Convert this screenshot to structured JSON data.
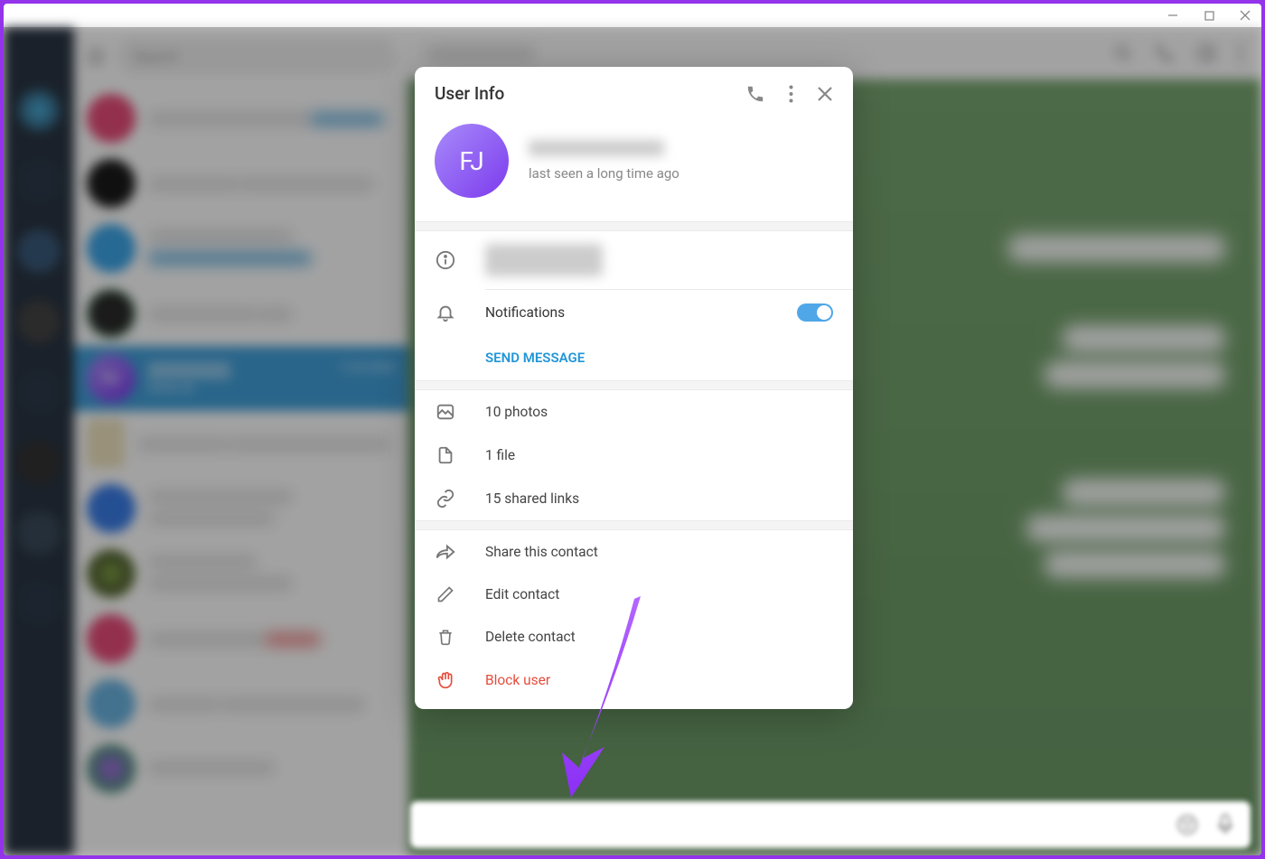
{
  "search": {
    "placeholder": "Search"
  },
  "active_chat": {
    "date": "1/22/2023",
    "last_msg": "Done sir",
    "avatar_initials": "FJ"
  },
  "modal": {
    "title": "User Info",
    "avatar_initials": "FJ",
    "status": "last seen a long time ago",
    "notifications_label": "Notifications",
    "notifications_on": true,
    "send_message": "SEND MESSAGE",
    "photos": "10 photos",
    "files": "1 file",
    "links": "15 shared links",
    "share": "Share this contact",
    "edit": "Edit contact",
    "delete": "Delete contact",
    "block": "Block user"
  },
  "icons": {
    "call": "phone-icon",
    "more": "more-vert-icon",
    "close": "close-icon",
    "info": "info-icon",
    "bell": "bell-icon",
    "image": "image-icon",
    "file": "file-icon",
    "link": "link-icon",
    "share": "share-icon",
    "edit": "edit-icon",
    "trash": "trash-icon",
    "hand": "hand-icon"
  }
}
